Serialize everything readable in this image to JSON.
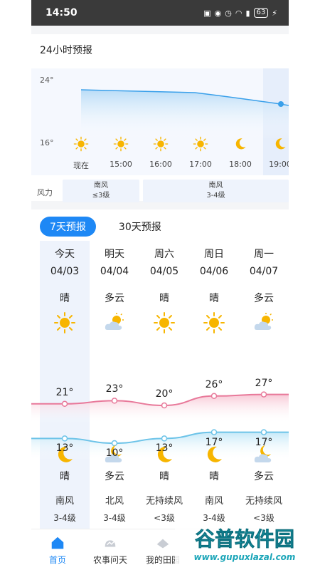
{
  "status": {
    "time": "14:50",
    "battery": "63"
  },
  "hourly": {
    "title": "24小时预报",
    "y_max": "24°",
    "y_min": "16°",
    "hours": [
      "现在",
      "15:00",
      "16:00",
      "17:00",
      "18:00",
      "19:00"
    ],
    "icons": [
      "sun-icon",
      "sun-icon",
      "sun-icon",
      "sun-icon",
      "moon-icon",
      "moon-icon"
    ],
    "wind_label": "风力",
    "winds": [
      {
        "dir": "南风",
        "level": "≤3级"
      },
      {
        "dir": "南风",
        "level": "3-4级"
      }
    ]
  },
  "weekly": {
    "tabs": [
      "7天预报",
      "30天预报"
    ],
    "days": [
      {
        "name": "今天",
        "date": "04/03",
        "day_cond": "晴",
        "day_icon": "sun-icon",
        "high": "21°",
        "low": "13°",
        "night_icon": "moon-icon",
        "night_cond": "晴",
        "wind": "南风",
        "level": "3-4级"
      },
      {
        "name": "明天",
        "date": "04/04",
        "day_cond": "多云",
        "day_icon": "partly-cloudy-icon",
        "high": "23°",
        "low": "10°",
        "night_icon": "cloudy-night-icon",
        "night_cond": "多云",
        "wind": "北风",
        "level": "3-4级"
      },
      {
        "name": "周六",
        "date": "04/05",
        "day_cond": "晴",
        "day_icon": "sun-icon",
        "high": "20°",
        "low": "13°",
        "night_icon": "moon-icon",
        "night_cond": "晴",
        "wind": "无持续风",
        "level": "<3级"
      },
      {
        "name": "周日",
        "date": "04/06",
        "day_cond": "晴",
        "day_icon": "sun-icon",
        "high": "26°",
        "low": "17°",
        "night_icon": "moon-icon",
        "night_cond": "晴",
        "wind": "南风",
        "level": "3-4级"
      },
      {
        "name": "周一",
        "date": "04/07",
        "day_cond": "多云",
        "day_icon": "partly-cloudy-icon",
        "high": "27°",
        "low": "17°",
        "night_icon": "cloudy-night-icon",
        "night_cond": "多云",
        "wind": "无持续风",
        "level": "<3级"
      }
    ]
  },
  "nav": [
    {
      "label": "首页",
      "icon": "home-icon"
    },
    {
      "label": "农事问天",
      "icon": "weather-icon"
    },
    {
      "label": "我的田园",
      "icon": "field-icon"
    }
  ],
  "watermark": {
    "brand": "谷普软件园",
    "url": "www.gupuxlazal.com"
  },
  "colors": {
    "accent": "#1e88f5",
    "high_line": "#e8799a",
    "low_line": "#6cc3e8",
    "sun": "#f7b500"
  }
}
